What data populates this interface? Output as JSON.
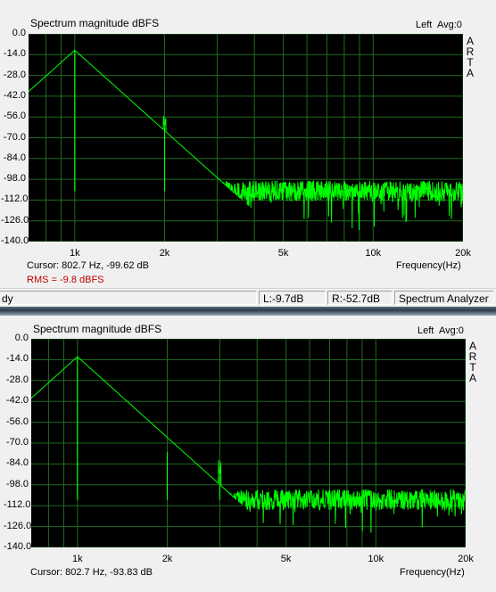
{
  "panels": [
    {
      "title": "Spectrum magnitude dBFS",
      "channel": "Left",
      "avg": "Avg:0",
      "arta": [
        "A",
        "R",
        "T",
        "A"
      ],
      "cursor": "Cursor:  802.7 Hz, -99.62 dB",
      "rms": "RMS =   -9.8 dBFS",
      "freq_axis_label": "Frequency(Hz)"
    },
    {
      "title": "Spectrum magnitude dBFS",
      "channel": "Left",
      "avg": "Avg:0",
      "arta": [
        "A",
        "R",
        "T",
        "A"
      ],
      "cursor": "Cursor:  802.7 Hz, -93.83 dB",
      "freq_axis_label": "Frequency(Hz)"
    }
  ],
  "statusbar": {
    "left_text": "dy",
    "left_level": "L:-9.7dB",
    "right_level": "R:-52.7dB",
    "mode": "Spectrum Analyzer"
  },
  "colors": {
    "trace": "#00ff00",
    "grid": "#1f6b1f",
    "plot_bg": "#000000",
    "rms_text": "#c00000"
  },
  "chart_data": [
    {
      "type": "line",
      "title": "Spectrum magnitude dBFS",
      "xlabel": "Frequency(Hz)",
      "ylabel": "",
      "x_scale": "log",
      "xlim": [
        700,
        20000
      ],
      "ylim": [
        -140,
        0
      ],
      "x_ticks": [
        {
          "v": 1000,
          "l": "1k"
        },
        {
          "v": 2000,
          "l": "2k"
        },
        {
          "v": 5000,
          "l": "5k"
        },
        {
          "v": 10000,
          "l": "10k"
        },
        {
          "v": 20000,
          "l": "20k"
        }
      ],
      "y_ticks": [
        "0.0",
        "-14.0",
        "-28.0",
        "-42.0",
        "-56.0",
        "-70.0",
        "-84.0",
        "-98.0",
        "-112.0",
        "-126.0",
        "-140.0"
      ],
      "grid": true,
      "noise_floor_db": -106,
      "series": [
        {
          "peaks": [
            {
              "x": 1000,
              "y": -11
            },
            {
              "x": 2000,
              "y": -63
            }
          ]
        }
      ]
    },
    {
      "type": "line",
      "title": "Spectrum magnitude dBFS",
      "xlabel": "Frequency(Hz)",
      "ylabel": "",
      "x_scale": "log",
      "xlim": [
        700,
        20000
      ],
      "ylim": [
        -140,
        0
      ],
      "x_ticks": [
        {
          "v": 1000,
          "l": "1k"
        },
        {
          "v": 2000,
          "l": "2k"
        },
        {
          "v": 5000,
          "l": "5k"
        },
        {
          "v": 10000,
          "l": "10k"
        },
        {
          "v": 20000,
          "l": "20k"
        }
      ],
      "y_ticks": [
        "0.0",
        "-14.0",
        "-28.0",
        "-42.0",
        "-56.0",
        "-70.0",
        "-84.0",
        "-98.0",
        "-112.0",
        "-126.0",
        "-140.0"
      ],
      "grid": true,
      "noise_floor_db": -108,
      "series": [
        {
          "peaks": [
            {
              "x": 1000,
              "y": -12
            },
            {
              "x": 2000,
              "y": -76
            },
            {
              "x": 3000,
              "y": -92
            }
          ]
        }
      ]
    }
  ]
}
